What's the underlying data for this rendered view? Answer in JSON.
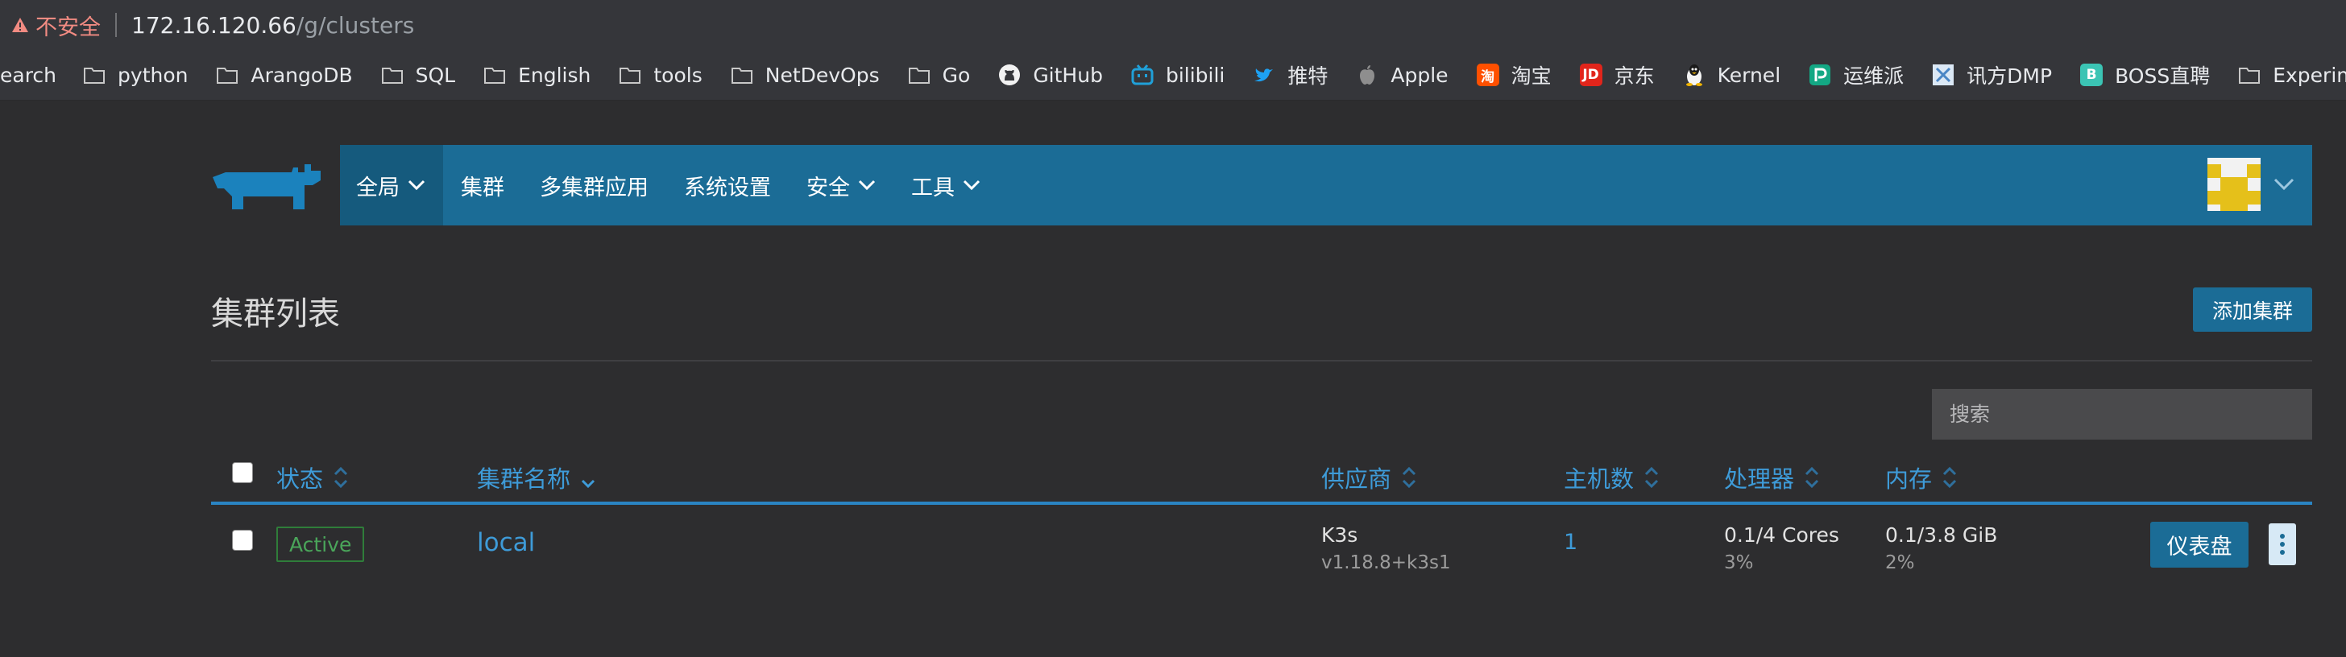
{
  "browser": {
    "security_label": "不安全",
    "url_host": "172.16.120.66",
    "url_path": "/g/clusters",
    "bookmarks": [
      {
        "label": "earch",
        "icon": "none"
      },
      {
        "label": "python",
        "icon": "folder-icon"
      },
      {
        "label": "ArangoDB",
        "icon": "folder-icon"
      },
      {
        "label": "SQL",
        "icon": "folder-icon"
      },
      {
        "label": "English",
        "icon": "folder-icon"
      },
      {
        "label": "tools",
        "icon": "folder-icon"
      },
      {
        "label": "NetDevOps",
        "icon": "folder-icon"
      },
      {
        "label": "Go",
        "icon": "folder-icon"
      },
      {
        "label": "GitHub",
        "icon": "github-icon"
      },
      {
        "label": "bilibili",
        "icon": "bilibili-icon"
      },
      {
        "label": "推特",
        "icon": "twitter-icon"
      },
      {
        "label": "Apple",
        "icon": "apple-icon"
      },
      {
        "label": "淘宝",
        "icon": "taobao-icon"
      },
      {
        "label": "京东",
        "icon": "jd-icon"
      },
      {
        "label": "Kernel",
        "icon": "linux-penguin-icon"
      },
      {
        "label": "运维派",
        "icon": "yunweipai-icon"
      },
      {
        "label": "讯方DMP",
        "icon": "xunfang-icon"
      },
      {
        "label": "BOSS直聘",
        "icon": "boss-icon"
      },
      {
        "label": "Experimental",
        "icon": "folder-icon"
      }
    ]
  },
  "nav": {
    "global_label": "全局",
    "items": [
      {
        "label": "集群",
        "dropdown": false
      },
      {
        "label": "多集群应用",
        "dropdown": false
      },
      {
        "label": "系统设置",
        "dropdown": false
      },
      {
        "label": "安全",
        "dropdown": true
      },
      {
        "label": "工具",
        "dropdown": true
      }
    ]
  },
  "page": {
    "title": "集群列表",
    "add_button": "添加集群",
    "search_placeholder": "搜索"
  },
  "table": {
    "headers": {
      "state": "状态",
      "name": "集群名称",
      "provider": "供应商",
      "nodes": "主机数",
      "cpu": "处理器",
      "memory": "内存"
    },
    "rows": [
      {
        "state": "Active",
        "name": "local",
        "provider": "K3s",
        "provider_version": "v1.18.8+k3s1",
        "nodes": "1",
        "cpu": "0.1/4 Cores",
        "cpu_pct": "3%",
        "memory": "0.1/3.8 GiB",
        "memory_pct": "2%",
        "dashboard_button": "仪表盘"
      }
    ]
  },
  "colors": {
    "nav_bg": "#1b6c96",
    "accent": "#3e9bd8",
    "active_green": "#4aa55a",
    "page_bg": "#2d2d2f"
  }
}
